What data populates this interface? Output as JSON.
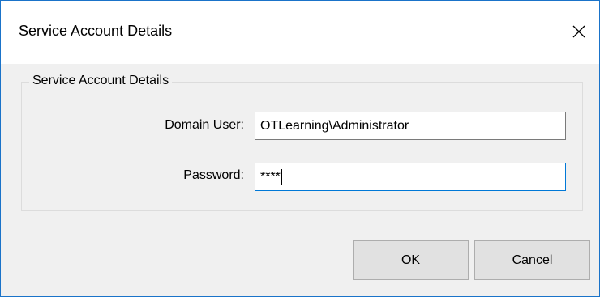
{
  "window": {
    "title": "Service Account Details",
    "close_icon": "close-icon",
    "accent_border": "#1a73c9"
  },
  "group": {
    "legend": "Service Account Details"
  },
  "form": {
    "domain_user_label": "Domain User:",
    "domain_user_value": "OTLearning\\Administrator",
    "password_label": "Password:",
    "password_value": "****"
  },
  "buttons": {
    "ok_label": "OK",
    "cancel_label": "Cancel"
  }
}
